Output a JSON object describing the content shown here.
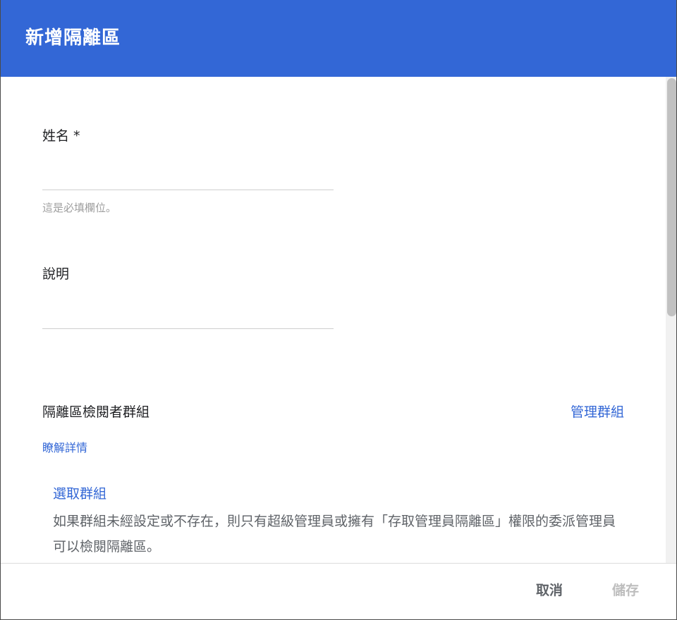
{
  "dialog": {
    "title": "新增隔離區"
  },
  "form": {
    "name_label": "姓名 *",
    "name_value": "",
    "name_hint": "這是必填欄位。",
    "description_label": "說明",
    "description_value": ""
  },
  "reviewer_section": {
    "title": "隔離區檢閱者群組",
    "manage_link": "管理群組",
    "learn_more": "瞭解詳情",
    "select_group": "選取群組",
    "note": "如果群組未經設定或不存在，則只有超級管理員或擁有「存取管理員隔離區」權限的委派管理員可以檢閱隔離區。"
  },
  "footer": {
    "cancel_label": "取消",
    "save_label": "儲存"
  },
  "colors": {
    "header_bg": "#3367d6",
    "link": "#3367d6",
    "disabled": "#bdbdbd"
  }
}
